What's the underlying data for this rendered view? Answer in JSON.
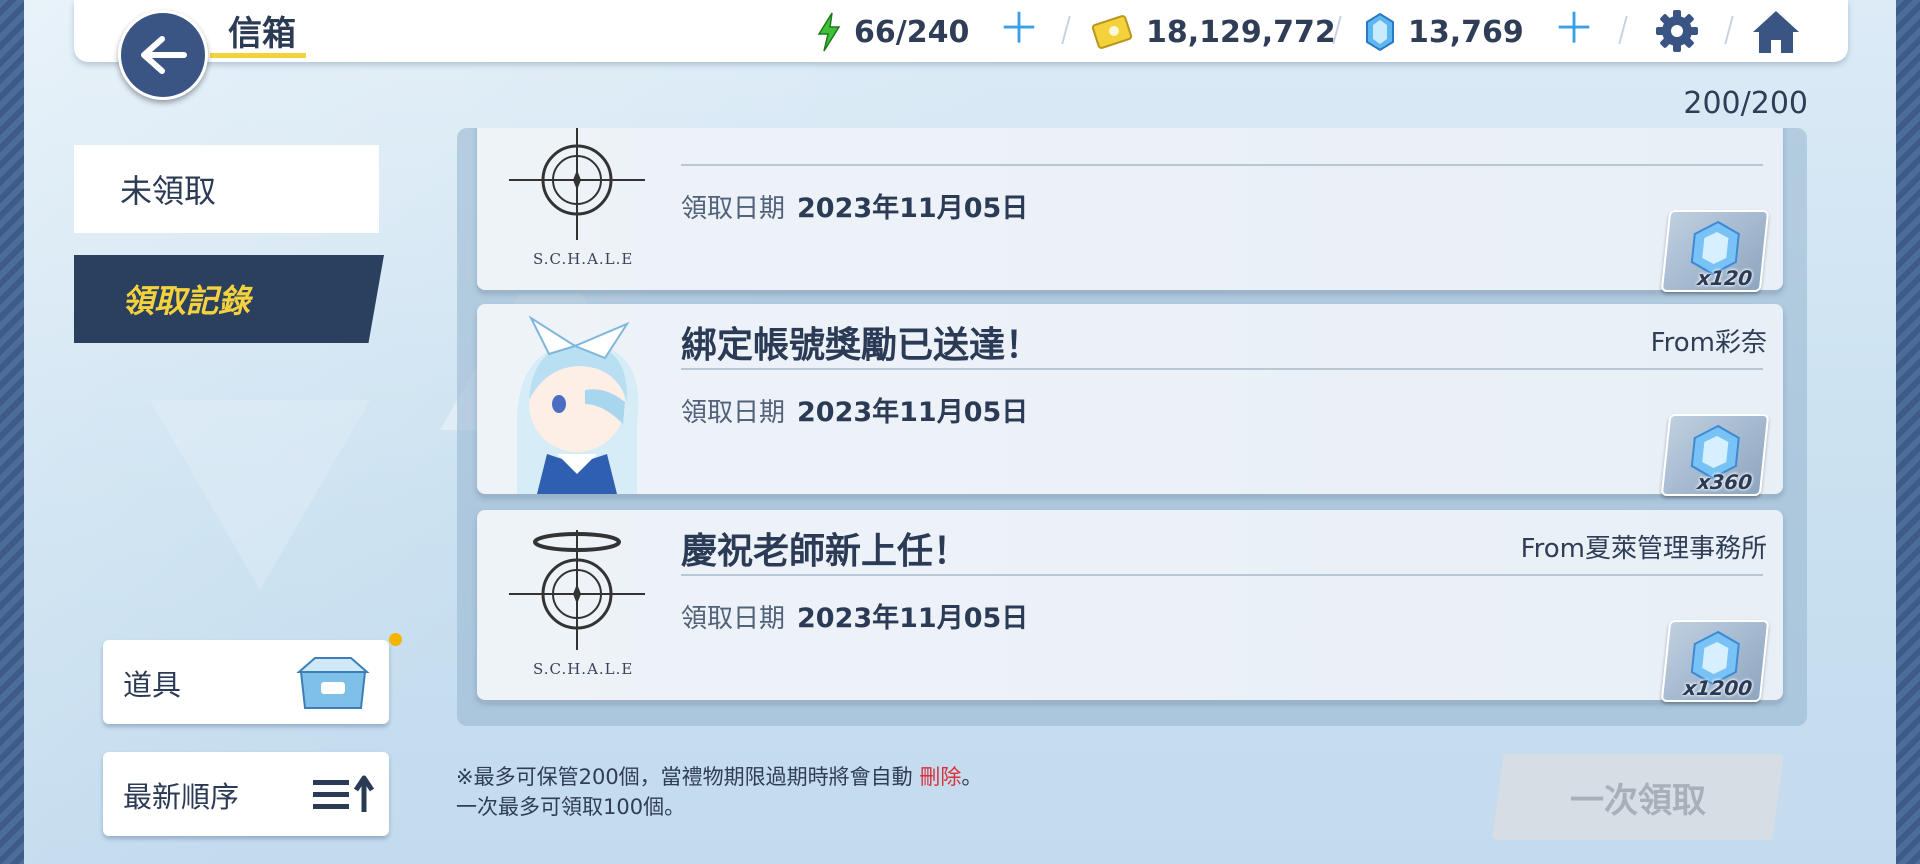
{
  "header": {
    "title": "信箱",
    "stamina": "66/240",
    "credits": "18,129,772",
    "gems": "13,769"
  },
  "mail_count": "200/200",
  "tabs": {
    "unclaimed": "未領取",
    "history": "領取記錄"
  },
  "mails": [
    {
      "title": "",
      "sender": "",
      "date_label": "領取日期",
      "date": "2023年11月05日",
      "reward_qty": "x120",
      "emblem_text": "S.C.H.A.L.E"
    },
    {
      "title": "綁定帳號獎勵已送達！",
      "sender": "From彩奈",
      "date_label": "領取日期",
      "date": "2023年11月05日",
      "reward_qty": "x360"
    },
    {
      "title": "慶祝老師新上任！",
      "sender": "From夏萊管理事務所",
      "date_label": "領取日期",
      "date": "2023年11月05日",
      "reward_qty": "x1200",
      "emblem_text": "S.C.H.A.L.E"
    }
  ],
  "items_button": "道具",
  "sort_button": "最新順序",
  "note": {
    "line1_a": "※最多可保管200個，當禮物期限過期時將會自動",
    "line1_delete": "刪除",
    "line1_end": "。",
    "line2": "一次最多可領取100個。"
  },
  "claim_all": "一次領取",
  "colors": {
    "accent_yellow": "#f4d23d",
    "navy": "#2b3f5e",
    "delete_red": "#d9303b"
  }
}
